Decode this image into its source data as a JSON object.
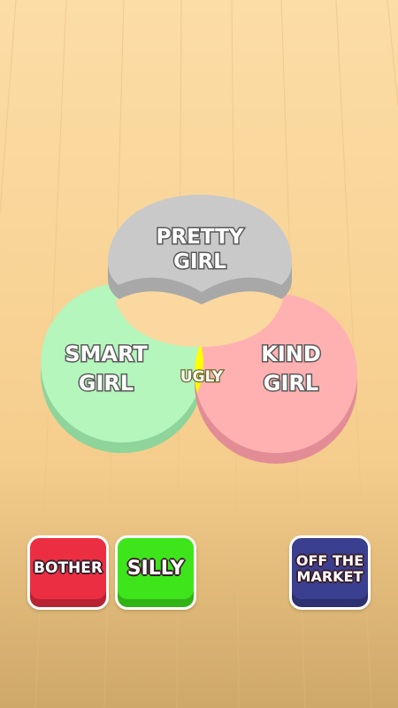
{
  "venn": {
    "top_label": "PRETTY\nGIRL",
    "left_label": "SMART\nGIRL",
    "right_label": "KIND\nGIRL",
    "center_label": "UGLY"
  },
  "answers": {
    "bother": "BOTHER",
    "silly": "SILLY",
    "off_the_market": "OFF THE\nMARKET"
  },
  "colors": {
    "background_top": "#fcdca4",
    "background_bottom": "#e8bf78",
    "pretty_circle": "#c9c9c9",
    "smart_circle": "#b4f6bc",
    "kind_circle": "#ffb1b1",
    "center_region": "#ffff00",
    "bother_button": "#ec2e43",
    "silly_button": "#3fe51b",
    "off_the_market_button": "#3b3f8f"
  }
}
